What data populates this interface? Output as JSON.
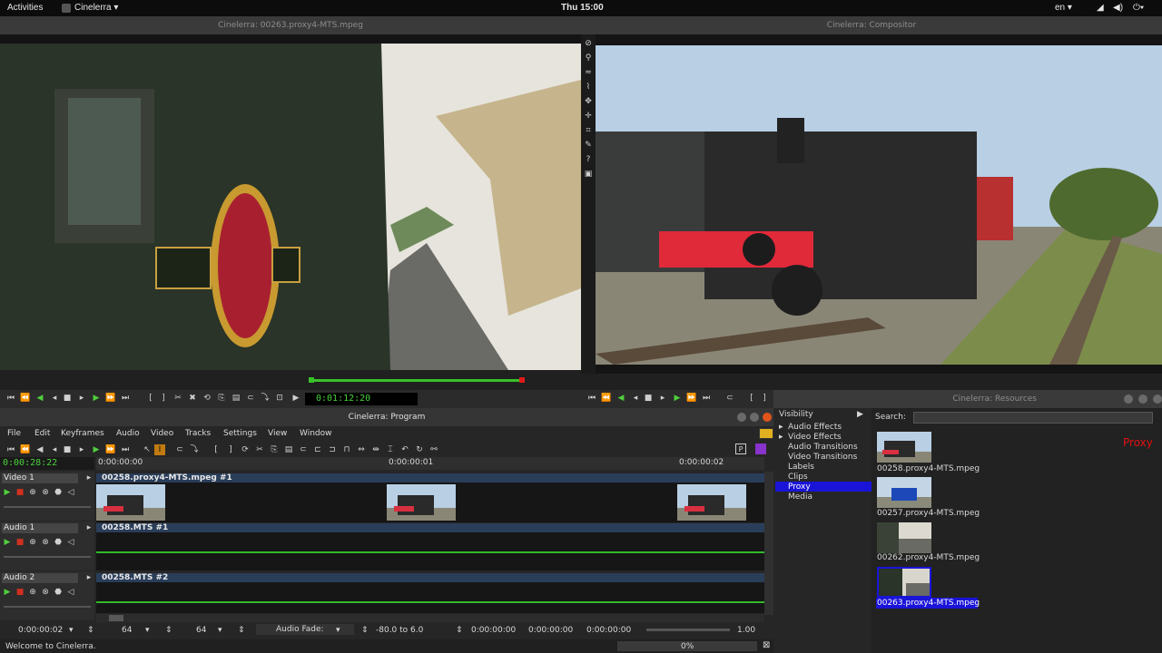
{
  "topbar": {
    "activities": "Activities",
    "app": "Cinelerra ▾",
    "clock": "Thu 15:00",
    "lang": "en ▾"
  },
  "viewer": {
    "title": "Cinelerra: 00263.proxy4-MTS.mpeg",
    "timecode": "0:01:12:20"
  },
  "compositor": {
    "title": "Cinelerra: Compositor"
  },
  "resources": {
    "title": "Cinelerra: Resources",
    "visibility": "Visibility",
    "search_label": "Search:",
    "proxy_label": "Proxy",
    "folders": [
      "Audio Effects",
      "Video Effects",
      "Audio Transitions",
      "Video Transitions",
      "Labels",
      "Clips",
      "Proxy",
      "Media"
    ],
    "selected_folder": "Proxy",
    "assets": [
      "00258.proxy4-MTS.mpeg",
      "00257.proxy4-MTS.mpeg",
      "00262.proxy4-MTS.mpeg",
      "00263.proxy4-MTS.mpeg"
    ],
    "selected_asset": "00263.proxy4-MTS.mpeg"
  },
  "program": {
    "title": "Cinelerra: Program",
    "menu": [
      "File",
      "Edit",
      "Keyframes",
      "Audio",
      "Video",
      "Tracks",
      "Settings",
      "View",
      "Window"
    ],
    "position": "0:00:28:22",
    "ruler": [
      "0:00:00:00",
      "0:00:00:01",
      "0:00:00:02"
    ],
    "tracks": [
      {
        "name": "Video 1",
        "edit": "00258.proxy4-MTS.mpeg #1"
      },
      {
        "name": "Audio 1",
        "edit": "00258.MTS #1"
      },
      {
        "name": "Audio 2",
        "edit": "00258.MTS #2"
      }
    ],
    "bottom": {
      "time": "0:00:00:02",
      "zoom1": "64",
      "zoom2": "64",
      "fade": "Audio Fade:",
      "range": "-80.0 to 6.0",
      "t1": "0:00:00:00",
      "t2": "0:00:00:00",
      "t3": "0:00:00:00",
      "speed": "1.00"
    },
    "status": "Welcome to Cinelerra.",
    "progress_label": "0%",
    "progress": 0
  },
  "colors": {
    "timecode": "#49d23b",
    "selection": "#1a14d8",
    "proxy": "#e01010",
    "track_bar": "#2a3e5a"
  }
}
